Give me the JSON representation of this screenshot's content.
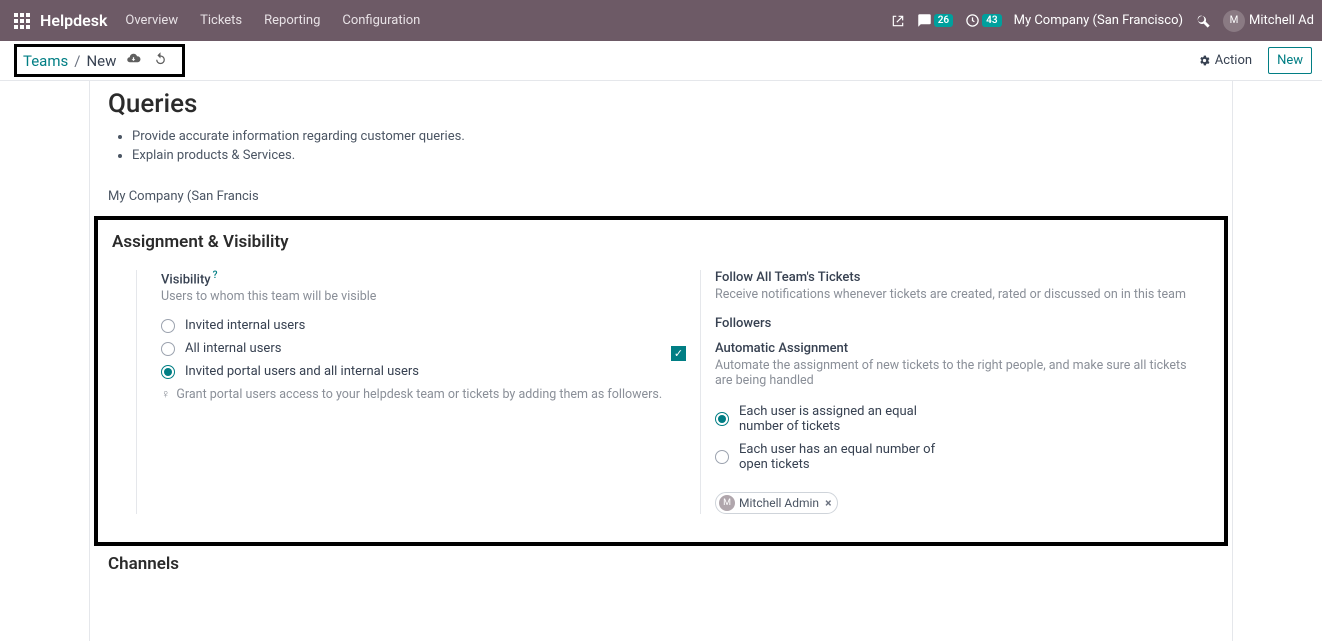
{
  "topnav": {
    "brand": "Helpdesk",
    "items": [
      "Overview",
      "Tickets",
      "Reporting",
      "Configuration"
    ],
    "messages_badge": "26",
    "activities_badge": "43",
    "company": "My Company (San Francisco)",
    "user": "Mitchell Ad"
  },
  "breadcrumb": {
    "root": "Teams",
    "current": "New"
  },
  "actions": {
    "action_label": "Action",
    "new_label": "New"
  },
  "main": {
    "queries_title": "Queries",
    "bullets": [
      "Provide accurate information regarding customer queries.",
      "Explain products & Services."
    ],
    "company_line": "My Company (San Francis",
    "av_title": "Assignment & Visibility",
    "visibility": {
      "label": "Visibility",
      "desc": "Users to whom this team will be visible",
      "options": [
        "Invited internal users",
        "All internal users",
        "Invited portal users and all internal users"
      ],
      "selected_index": 2,
      "hint": "Grant portal users access to your helpdesk team or tickets by adding them as followers."
    },
    "follow": {
      "label": "Follow All Team's Tickets",
      "desc": "Receive notifications whenever tickets are created, rated or discussed on in this team",
      "followers_label": "Followers"
    },
    "auto": {
      "checked": true,
      "label": "Automatic Assignment",
      "desc": "Automate the assignment of new tickets to the right people, and make sure all tickets are being handled",
      "options": [
        "Each user is assigned an equal number of tickets",
        "Each user has an equal number of open tickets"
      ],
      "selected_index": 0,
      "tag": "Mitchell Admin"
    },
    "channels_title": "Channels"
  }
}
